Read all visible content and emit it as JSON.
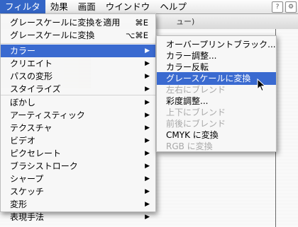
{
  "menubar": {
    "items": [
      "フィルタ",
      "効果",
      "画面",
      "ウインドウ",
      "ヘルプ"
    ],
    "active_index": 0
  },
  "window": {
    "title_fragment": "ュー)"
  },
  "filter_menu": {
    "items": [
      {
        "label": "グレースケールに変換を適用",
        "shortcut": "⌘E",
        "submenu": false
      },
      {
        "label": "グレースケールに変換",
        "shortcut": "⌥⌘E",
        "submenu": false
      },
      {
        "label": "カラー",
        "submenu": true,
        "highlighted": true
      },
      {
        "label": "クリエイト",
        "submenu": true
      },
      {
        "label": "パスの変形",
        "submenu": true
      },
      {
        "label": "スタイライズ",
        "submenu": true
      },
      {
        "label": "ぼかし",
        "submenu": true
      },
      {
        "label": "アーティスティック",
        "submenu": true
      },
      {
        "label": "テクスチャ",
        "submenu": true
      },
      {
        "label": "ビデオ",
        "submenu": true
      },
      {
        "label": "ピクセレート",
        "submenu": true
      },
      {
        "label": "ブラシストローク",
        "submenu": true
      },
      {
        "label": "シャープ",
        "submenu": true
      },
      {
        "label": "スケッチ",
        "submenu": true
      },
      {
        "label": "変形",
        "submenu": true
      },
      {
        "label": "表現手法",
        "submenu": true
      }
    ]
  },
  "color_submenu": {
    "items": [
      {
        "label": "オーバープリントブラック...",
        "enabled": true
      },
      {
        "label": "カラー調整...",
        "enabled": true
      },
      {
        "label": "カラー反転",
        "enabled": true
      },
      {
        "label": "グレースケールに変換",
        "enabled": true,
        "highlighted": true
      },
      {
        "label": "左右にブレンド",
        "enabled": false
      },
      {
        "label": "彩度調整...",
        "enabled": true
      },
      {
        "label": "上下にブレンド",
        "enabled": false
      },
      {
        "label": "前後にブレンド",
        "enabled": false
      },
      {
        "label": "CMYK に変換",
        "enabled": true
      },
      {
        "label": "RGB に変換",
        "enabled": false
      }
    ]
  },
  "icons": {
    "submenu_arrow": "▶",
    "cursor": "arrow-cursor"
  },
  "colors": {
    "highlight": "#3a6ad0",
    "disabled_text": "#a8a8a8"
  }
}
